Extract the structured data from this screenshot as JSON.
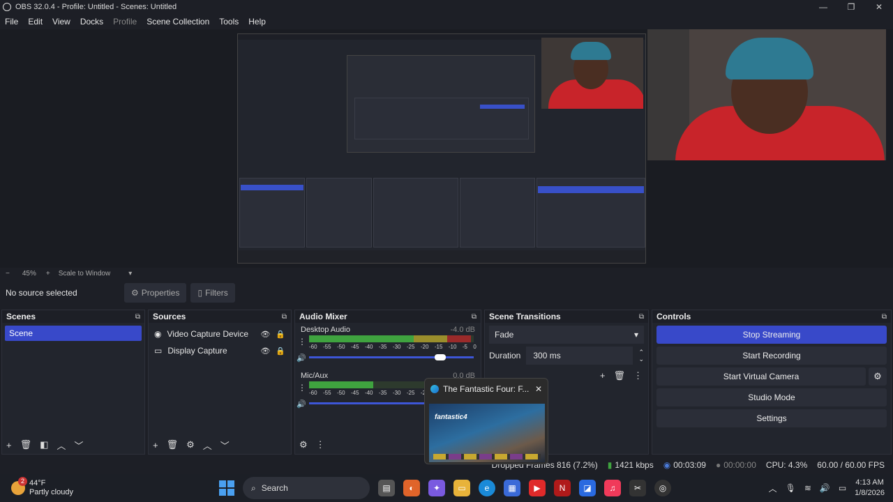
{
  "window": {
    "title": "OBS 32.0.4 - Profile: Untitled - Scenes: Untitled",
    "controls": [
      "—",
      "❐",
      "✕"
    ]
  },
  "menu": [
    "File",
    "Edit",
    "View",
    "Docks",
    "Profile",
    "Scene Collection",
    "Tools",
    "Help"
  ],
  "zoom": {
    "minus": "−",
    "value": "45%",
    "plus": "+",
    "mode": "Scale to Window"
  },
  "source_bar": {
    "status": "No source selected",
    "properties": "Properties",
    "filters": "Filters"
  },
  "scenes": {
    "title": "Scenes",
    "items": [
      "Scene"
    ]
  },
  "sources": {
    "title": "Sources",
    "items": [
      {
        "name": "Video Capture Device",
        "icon": "camera-icon"
      },
      {
        "name": "Display Capture",
        "icon": "monitor-icon"
      }
    ]
  },
  "audio_mixer": {
    "title": "Audio Mixer",
    "channels": [
      {
        "name": "Desktop Audio",
        "db": "-4.0 dB",
        "volume": 0.8
      },
      {
        "name": "Mic/Aux",
        "db": "0.0 dB",
        "volume": 1.0
      }
    ],
    "scale": [
      "-60",
      "-55",
      "-50",
      "-45",
      "-40",
      "-35",
      "-30",
      "-25",
      "-20",
      "-15",
      "-10",
      "-5",
      "0"
    ]
  },
  "scene_transitions": {
    "title": "Scene Transitions",
    "transition": "Fade",
    "duration_label": "Duration",
    "duration_value": "300 ms"
  },
  "controls": {
    "title": "Controls",
    "stop_streaming": "Stop Streaming",
    "start_recording": "Start Recording",
    "start_virtual_camera": "Start Virtual Camera",
    "studio_mode": "Studio Mode",
    "settings": "Settings"
  },
  "statusbar": {
    "dropped": "Dropped Frames 816 (7.2%)",
    "bitrate": "1421 kbps",
    "stream_time": "00:03:09",
    "rec_time": "00:00:00",
    "cpu": "CPU: 4.3%",
    "fps": "60.00 / 60.00 FPS"
  },
  "thumbnail": {
    "title": "The Fantastic Four: F...",
    "close": "✕",
    "logo_text": "fantastic4"
  },
  "taskbar": {
    "weather_temp": "44°F",
    "weather_desc": "Partly cloudy",
    "weather_badge": "2",
    "search": "Search",
    "time": "4:13 AM",
    "date": "1/8/2026"
  },
  "colors": {
    "accent": "#3849c9",
    "background": "#1d1f26",
    "panel": "#22252d"
  }
}
